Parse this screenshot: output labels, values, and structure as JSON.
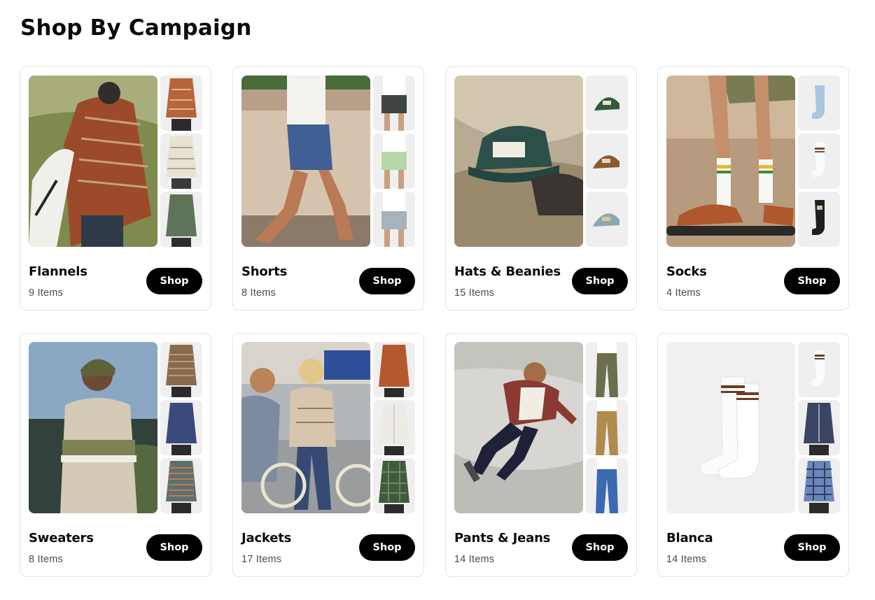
{
  "page": {
    "title": "Shop By Campaign"
  },
  "shop_label": "Shop",
  "campaigns": [
    {
      "name": "Flannels",
      "count": "9 Items"
    },
    {
      "name": "Shorts",
      "count": "8 Items"
    },
    {
      "name": "Hats & Beanies",
      "count": "15 Items"
    },
    {
      "name": "Socks",
      "count": "4 Items"
    },
    {
      "name": "Sweaters",
      "count": "8 Items"
    },
    {
      "name": "Jackets",
      "count": "17 Items"
    },
    {
      "name": "Pants & Jeans",
      "count": "14 Items"
    },
    {
      "name": "Blanca",
      "count": "14 Items"
    }
  ]
}
